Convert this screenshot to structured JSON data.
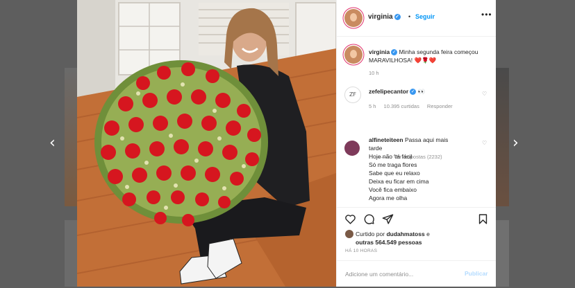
{
  "navigation": {
    "prev_icon": "chevron-left-icon",
    "next_icon": "chevron-right-icon"
  },
  "post": {
    "author": "virginia",
    "follow_label": "Seguir",
    "more_icon": "more-options-icon"
  },
  "caption": {
    "username": "virginia",
    "text": "Minha segunda feira começou MARAVILHOSA! ❤️🌹❤️",
    "time": "10 h"
  },
  "comments": [
    {
      "username": "zefelipecantor",
      "emoji": "👀",
      "time": "5 h",
      "likes": "10.395 curtidas",
      "reply_label": "Responder",
      "view_replies": "Ver respostas (2232)"
    },
    {
      "username": "alfineteiteen",
      "text_lines": [
        "Passa aqui mais",
        "tarde",
        "Hoje não 'tá fácil",
        "Só me traga flores",
        "Sabe que eu relaxo",
        "Deixa eu ficar em cima",
        "Você fica embaixo",
        "Agora me olha"
      ]
    }
  ],
  "actions": {
    "like_icon": "heart-icon",
    "comment_icon": "comment-icon",
    "share_icon": "share-icon",
    "save_icon": "bookmark-icon"
  },
  "likes": {
    "prefix": "Curtido por",
    "user": "dudahmatoss",
    "middle": "e",
    "others": "outras 564.549 pessoas"
  },
  "timestamp": "HÁ 10 HORAS",
  "comment_input": {
    "placeholder": "Adicione um comentário...",
    "publish_label": "Publicar"
  },
  "colors": {
    "accent": "#0095f6",
    "verified": "#3897f0",
    "publish_disabled": "#b3dbff"
  }
}
